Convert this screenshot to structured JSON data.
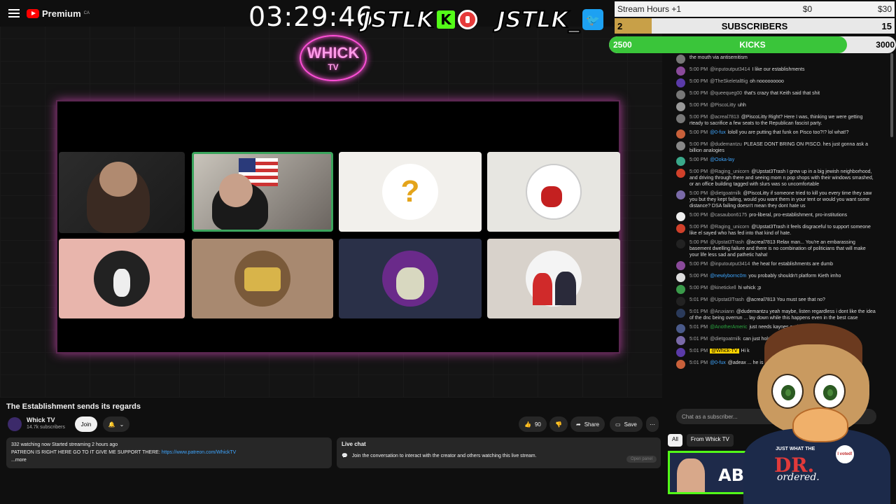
{
  "app": {
    "brand": "Premium",
    "brand_region": "CA"
  },
  "overlay": {
    "timer": "03:29:46",
    "brand_left": "JSTLK",
    "brand_right": "JSTLK_",
    "neon_logo": "WHICK",
    "neon_sub": "TV"
  },
  "widgets": {
    "stream_hours": "Stream Hours +1",
    "goal_current": "$0",
    "goal_target": "$30",
    "subs_count": "2",
    "subs_label": "SUBSCRIBERS",
    "subs_goal": "15",
    "subs_progress": 0.133,
    "kicks_current": "2500",
    "kicks_label": "KICKS",
    "kicks_goal": "3000",
    "kicks_progress": 0.83
  },
  "chat": {
    "messages": [
      {
        "time": "",
        "name": "",
        "text": "the mouth via antisemitism",
        "color": "#777"
      },
      {
        "time": "5:00 PM",
        "name": "@inputoutput3414",
        "text": "I like our establishments",
        "color": "#8a4a9a"
      },
      {
        "time": "5:00 PM",
        "name": "@TheSkeletalBig",
        "text": "oh nooooooooo",
        "color": "#5a3aa8"
      },
      {
        "time": "5:00 PM",
        "name": "@queequeg00",
        "text": "that's crazy that Keith said that shit",
        "color": "#777"
      },
      {
        "time": "5:00 PM",
        "name": "@PiscoLitty",
        "text": "uhh",
        "color": "#999"
      },
      {
        "time": "5:00 PM",
        "name": "@acreal7813",
        "text": "@PiscoLitty Right? Here I was, thinking we were getting rteady to sacrifice a few seats to the Republican fascist party.",
        "color": "#777"
      },
      {
        "time": "5:00 PM",
        "name": "@0-fux",
        "text": "lololl you are putting that funk on Pisco too?!? lol what!?",
        "color": "#c8603a",
        "nameClass": "blue"
      },
      {
        "time": "5:00 PM",
        "name": "@dudemantzu",
        "text": "PLEASE DONT BRING ON PISCO. hes just gonna ask a billion analogies",
        "color": "#888"
      },
      {
        "time": "5:00 PM",
        "name": "@Ooka-lay",
        "text": "",
        "color": "#3aa88a",
        "nameClass": "blue"
      },
      {
        "time": "5:00 PM",
        "name": "@Raging_unicorn",
        "text": "@Upstat3Trash I grew up in a big jewish neighborhood, and driving through there and seeing mom n pop shops with their windows smashed, or an office building tagged with slurs was so uncomfortable",
        "color": "#d0402a"
      },
      {
        "time": "5:00 PM",
        "name": "@dietgoatmilk",
        "text": "@PiscoLitty if someone tried to kill you every time they saw you but they kept failing, would you want them in your tent or would you want some distance? DSA failing doesn't mean they dont hate us",
        "color": "#7a6aa8"
      },
      {
        "time": "5:00 PM",
        "name": "@casaubon6175",
        "text": "pro-liberal, pro-establishment, pro-institutions",
        "color": "#eee"
      },
      {
        "time": "5:00 PM",
        "name": "@Raging_unicorn",
        "text": "@Upstat3Trash it feels disgraceful to support someone like el sayed who has fed into that kind of hate.",
        "color": "#d0402a"
      },
      {
        "time": "5:00 PM",
        "name": "@Upstat3Trash",
        "text": "@acreal7813 Relax man... You're an embarassing basement dwelling failure and there is no combination of politicians that will make your life less sad and pathetic haha!",
        "color": "#222"
      },
      {
        "time": "5:00 PM",
        "name": "@inputoutput3414",
        "text": "the heat for establishments are dumb",
        "color": "#8a4a9a"
      },
      {
        "time": "5:00 PM",
        "name": "@newlybornc0m",
        "text": "you probably shouldn't platform Kieth imho",
        "color": "#ddd",
        "nameClass": "blue"
      },
      {
        "time": "5:00 PM",
        "name": "@kinetickell",
        "text": "hi whick ;p",
        "color": "#3a9a4a"
      },
      {
        "time": "5:01 PM",
        "name": "@Upstat3Trash",
        "text": "@acreal7813 You must see that no?",
        "color": "#222"
      },
      {
        "time": "5:01 PM",
        "name": "@Aruxiann",
        "text": "@dudemantzu yeah maybe, listen regardless i dont like the idea of the dnc being overrun ... lay down while this happens even in the best case",
        "color": "#2a3a5a"
      },
      {
        "time": "5:01 PM",
        "name": "@AnotherAmeric",
        "text": "just needs kaynes end",
        "color": "#4a5a8a",
        "nameClass": "green"
      },
      {
        "time": "5:01 PM",
        "name": "@dietgoatmilk",
        "text": "can just hold back with a ... nice",
        "color": "#7a6aa8"
      },
      {
        "time": "5:01 PM",
        "name": "@Whick-TV",
        "text": "Hi k",
        "color": "#5a3aa8",
        "nameClass": "badge"
      },
      {
        "time": "5:01 PM",
        "name": "@0-fux",
        "text": "@adeax ... he is used to it by now",
        "color": "#c8603a",
        "nameClass": "blue"
      }
    ],
    "input_placeholder": "Chat as a subscriber...",
    "chip_all": "All",
    "chip_from": "From Whick TV",
    "thumb_text": "AB"
  },
  "mascot": {
    "line1": "JUST WHAT THE",
    "line2": "DR.",
    "line3": "ordered.",
    "badge": "I voted!"
  },
  "video": {
    "title": "The Establishment sends its regards",
    "channel": "Whick TV",
    "subscribers": "14.7k subscribers",
    "join": "Join",
    "likes": "90",
    "share": "Share",
    "save": "Save"
  },
  "description": {
    "stats": "332 watching now  Started streaming 2 hours ago",
    "text": "PATREON IS RIGHT HERE GO TO IT GIVE ME SUPPORT THERE: ",
    "link": "https://www.patreon.com/WhickTV",
    "more": "...more"
  },
  "livechat": {
    "header": "Live chat",
    "text": "Join the conversation to interact with the creator and others watching this live stream.",
    "open_panel": "Open panel"
  }
}
